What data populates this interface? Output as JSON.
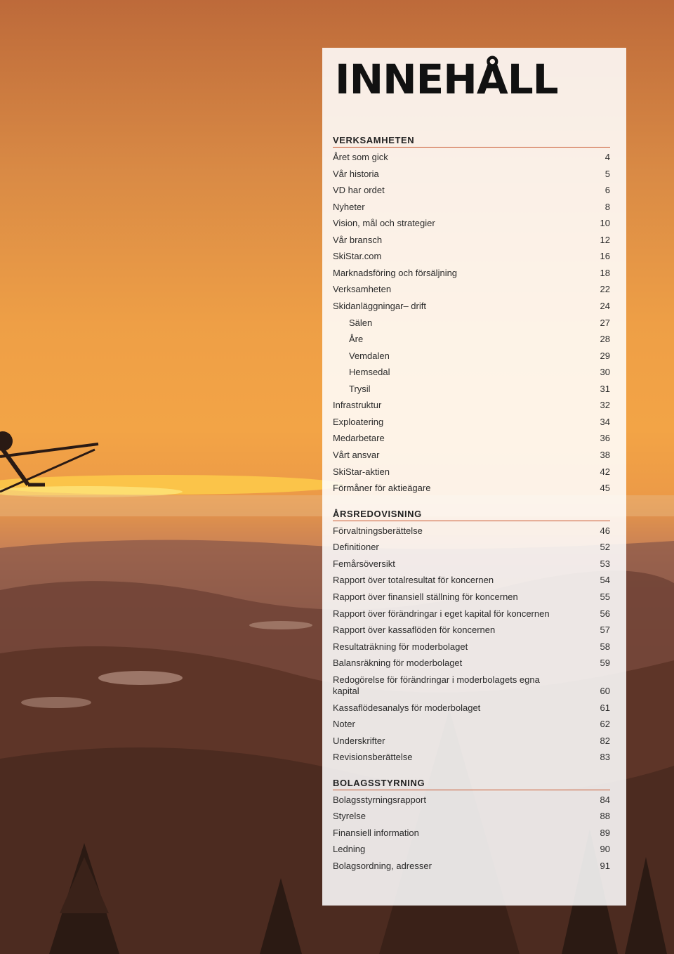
{
  "title": "INNEHÅLL",
  "sections": [
    {
      "heading": "VERKSAMHETEN",
      "items": [
        {
          "label": "Året som gick",
          "page": "4"
        },
        {
          "label": "Vår historia",
          "page": "5"
        },
        {
          "label": "VD har ordet",
          "page": "6"
        },
        {
          "label": "Nyheter",
          "page": "8"
        },
        {
          "label": "Vision, mål och strategier",
          "page": "10"
        },
        {
          "label": "Vår bransch",
          "page": "12"
        },
        {
          "label": "SkiStar.com",
          "page": "16"
        },
        {
          "label": "Marknadsföring och försäljning",
          "page": "18"
        },
        {
          "label": "Verksamheten",
          "page": "22"
        },
        {
          "label": "Skidanläggningar– drift",
          "page": "24"
        },
        {
          "label": "Sälen",
          "page": "27"
        },
        {
          "label": "Åre",
          "page": "28"
        },
        {
          "label": "Vemdalen",
          "page": "29"
        },
        {
          "label": "Hemsedal",
          "page": "30"
        },
        {
          "label": "Trysil",
          "page": "31"
        },
        {
          "label": "Infrastruktur",
          "page": "32"
        },
        {
          "label": "Exploatering",
          "page": "34"
        },
        {
          "label": "Medarbetare",
          "page": "36"
        },
        {
          "label": "Vårt ansvar",
          "page": "38"
        },
        {
          "label": "SkiStar-aktien",
          "page": "42"
        },
        {
          "label": "Förmåner för aktieägare",
          "page": "45"
        }
      ]
    },
    {
      "heading": "ÅRSREDOVISNING",
      "items": [
        {
          "label": "Förvaltningsberättelse",
          "page": "46"
        },
        {
          "label": "Definitioner",
          "page": "52"
        },
        {
          "label": "Femårsöversikt",
          "page": "53"
        },
        {
          "label": "Rapport över totalresultat för koncernen",
          "page": "54"
        },
        {
          "label": "Rapport över finansiell ställning för koncernen",
          "page": "55"
        },
        {
          "label": "Rapport över förändringar i eget kapital för koncernen",
          "page": "56"
        },
        {
          "label": "Rapport över kassaflöden för koncernen",
          "page": "57"
        },
        {
          "label": "Resultaträkning för moderbolaget",
          "page": "58"
        },
        {
          "label": "Balansräkning för moderbolaget",
          "page": "59"
        },
        {
          "label": "Redogörelse för förändringar i moderbolagets egna kapital",
          "page": "60"
        },
        {
          "label": "Kassaflödesanalys för moderbolaget",
          "page": "61"
        },
        {
          "label": "Noter",
          "page": "62"
        },
        {
          "label": "Underskrifter",
          "page": "82"
        },
        {
          "label": "Revisionsberättelse",
          "page": "83"
        }
      ]
    },
    {
      "heading": "BOLAGSSTYRNING",
      "items": [
        {
          "label": "Bolagsstyrningsrapport",
          "page": "84"
        },
        {
          "label": "Styrelse",
          "page": "88"
        },
        {
          "label": "Finansiell information",
          "page": "89"
        },
        {
          "label": "Ledning",
          "page": "90"
        },
        {
          "label": "Bolagsordning, adresser",
          "page": "91"
        }
      ]
    }
  ]
}
